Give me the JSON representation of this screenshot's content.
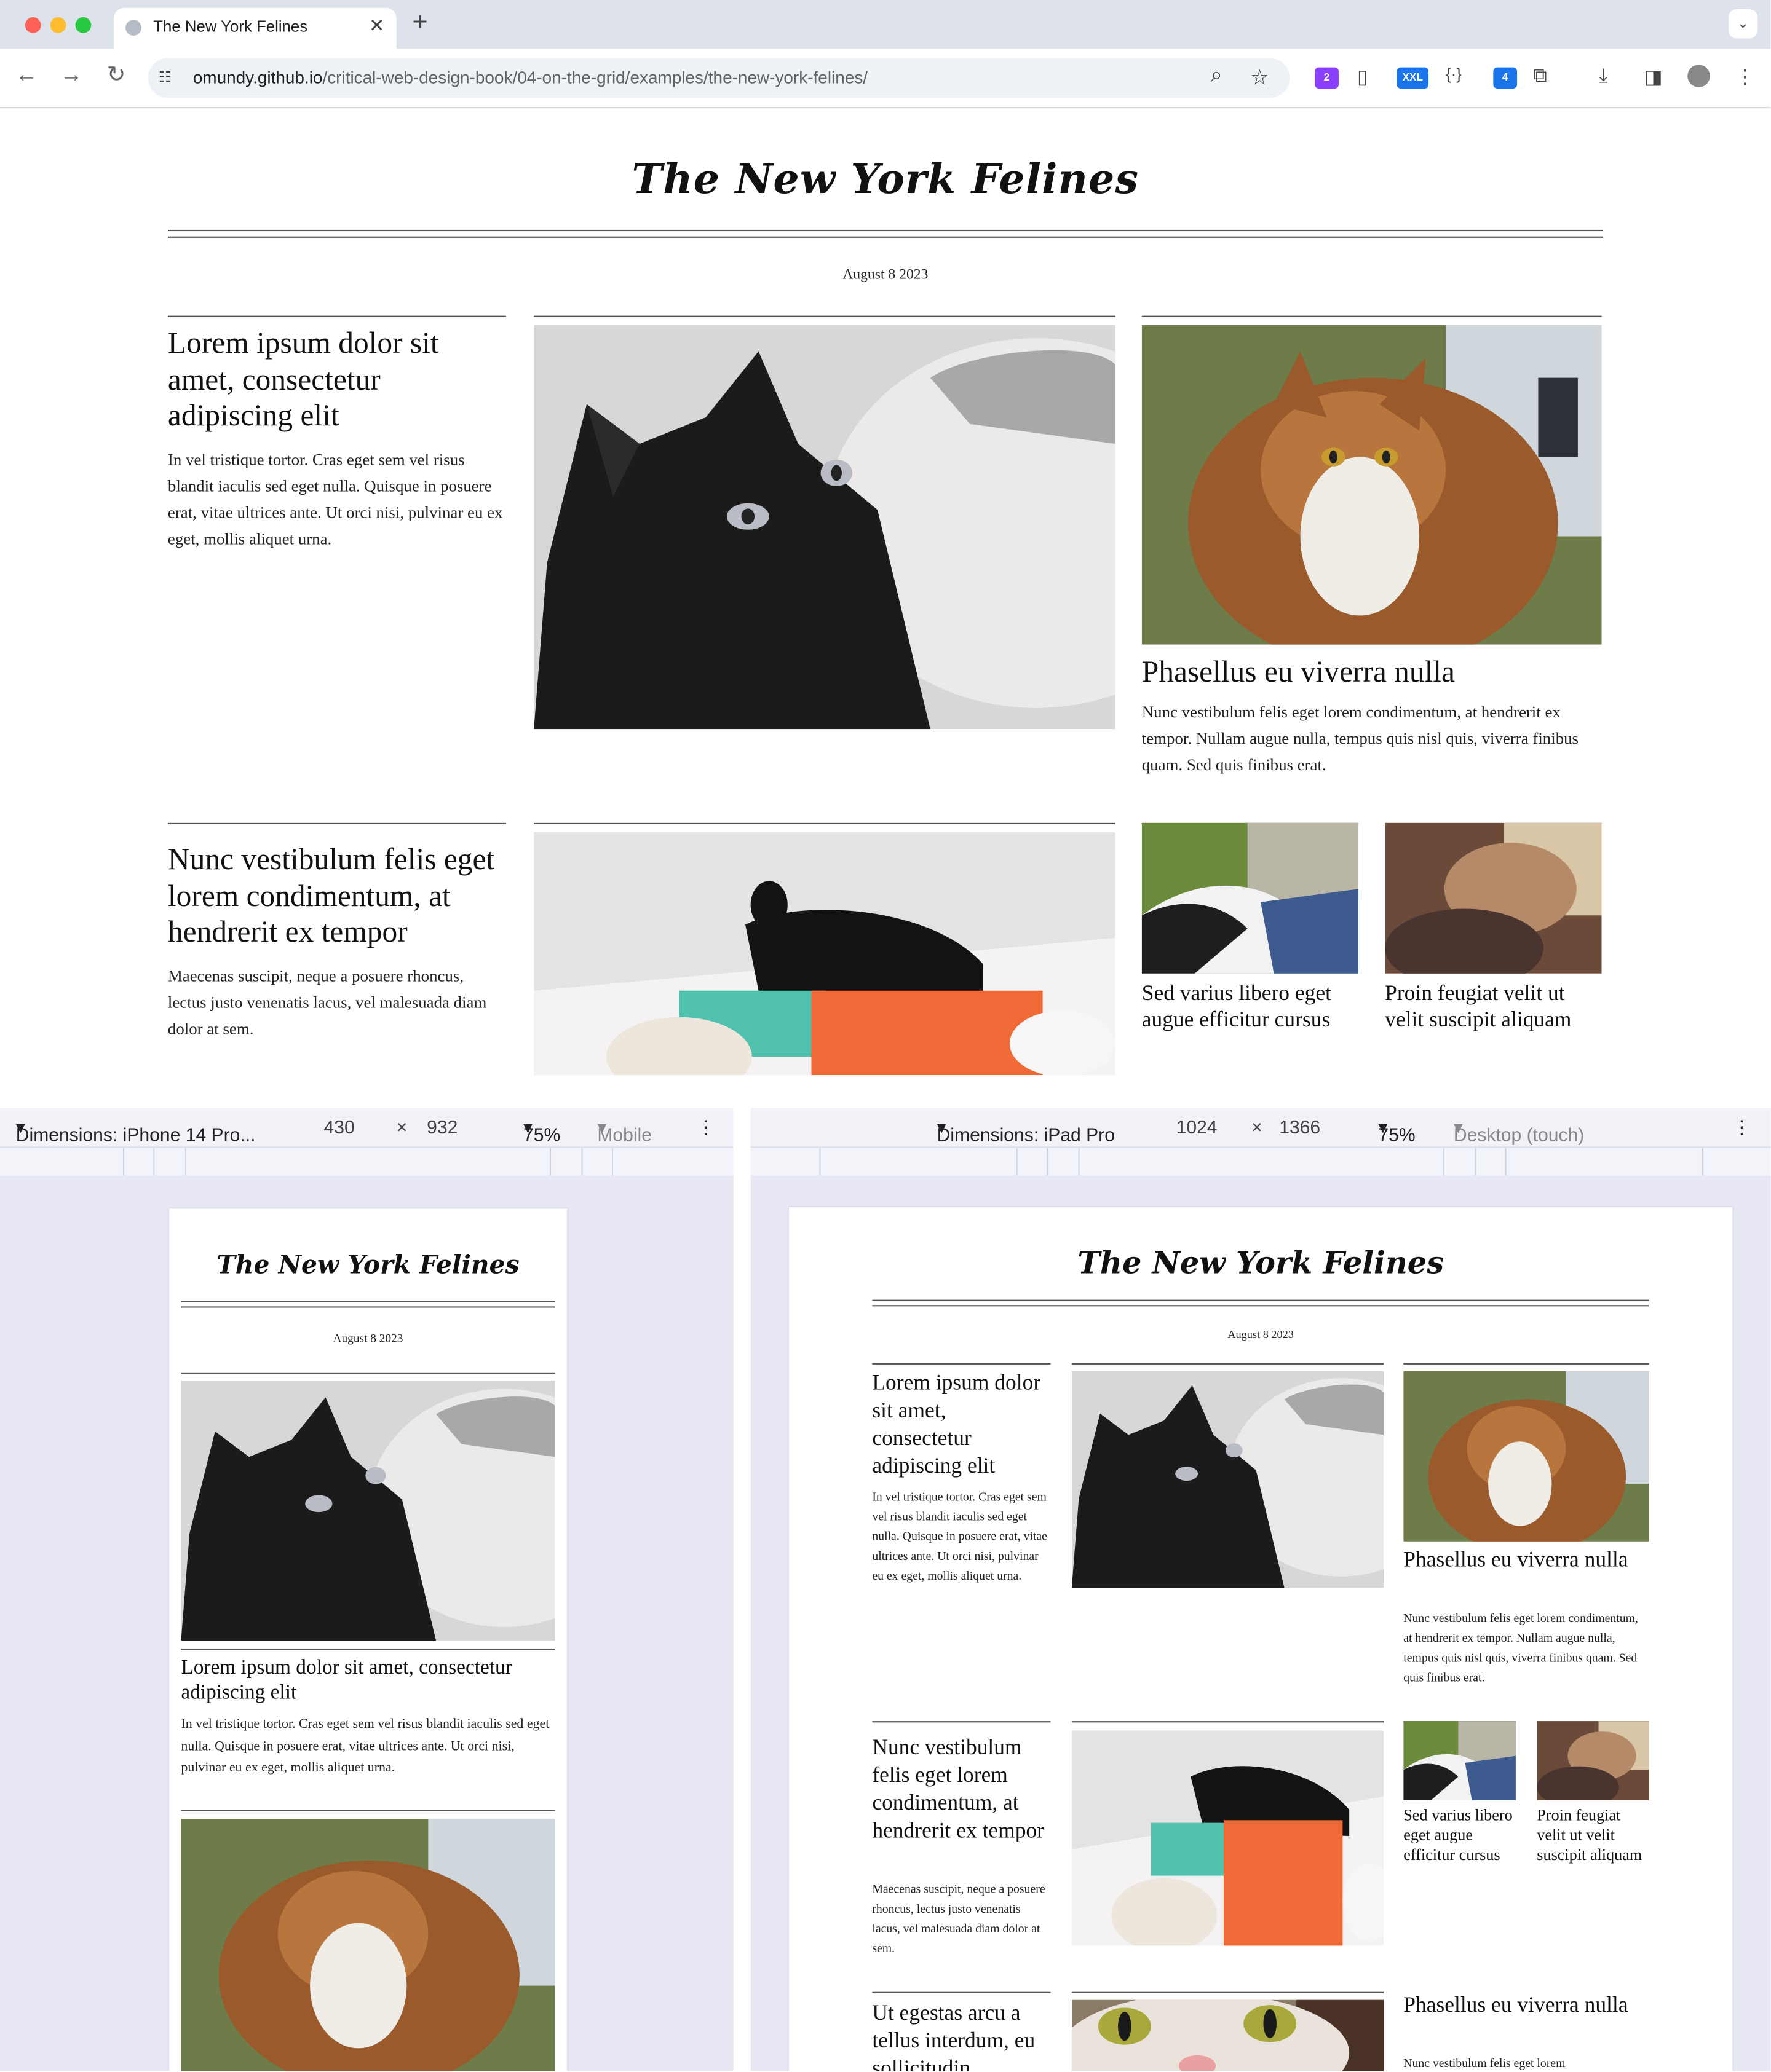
{
  "browser": {
    "tab_title": "The New York Felines",
    "url_host": "omundy.github.io",
    "url_path": "/critical-web-design-book/04-on-the-grid/examples/the-new-york-felines/",
    "extensions": [
      {
        "name": "extension-badge-2",
        "label": "2",
        "color": "#8a3ffc"
      },
      {
        "name": "xxl-extension",
        "label": "XXL",
        "color": "#1a73e8"
      },
      {
        "name": "extension-badge-4",
        "label": "4",
        "color": "#1a73e8"
      }
    ]
  },
  "site": {
    "masthead": "The New York Felines",
    "date": "August 8 2023",
    "articles": [
      {
        "headline": "Lorem ipsum dolor sit amet, consectetur adipiscing elit",
        "body": "In vel tristique tortor. Cras eget sem vel risus blandit iaculis sed eget nulla. Quisque in posuere erat, vitae ultrices ante. Ut orci nisi, pulvinar eu ex eget, mollis aliquet urna."
      },
      {
        "headline": "Phasellus eu viverra nulla",
        "body": "Nunc vestibulum felis eget lorem condimentum, at hendrerit ex tempor. Nullam augue nulla, tempus quis nisl quis, viverra finibus quam. Sed quis finibus erat."
      },
      {
        "headline": "Nunc vestibulum felis eget lorem condimentum, at hendrerit ex tempor",
        "body": "Maecenas suscipit, neque a posuere rhoncus, lectus justo venenatis lacus, vel malesuada diam dolor at sem."
      },
      {
        "headline": "Sed varius libero eget augue efficitur cursus"
      },
      {
        "headline": "Proin feugiat velit ut velit suscipit aliquam"
      },
      {
        "headline": "Ut egestas arcu a tellus interdum, eu sollicitudin"
      },
      {
        "headline": "Phasellus eu viverra nulla",
        "body": "Nunc vestibulum felis eget lorem"
      }
    ]
  },
  "devtools": {
    "mobile": {
      "device": "Dimensions: iPhone 14 Pro...",
      "width": "430",
      "times": "×",
      "height": "932",
      "zoom": "75%",
      "mode": "Mobile"
    },
    "tablet": {
      "device": "Dimensions: iPad Pro",
      "width": "1024",
      "times": "×",
      "height": "1366",
      "zoom": "75%",
      "mode": "Desktop (touch)"
    }
  },
  "colors": {
    "accent": "#1a73e8",
    "devtools_bg": "#e7e8f4"
  }
}
